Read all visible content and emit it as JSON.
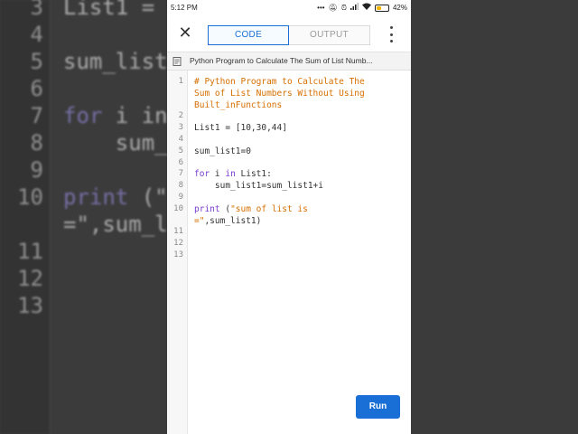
{
  "background": {
    "lines": [
      {
        "no": "3",
        "text": "List1 = "
      },
      {
        "no": "4",
        "text": ""
      },
      {
        "no": "5",
        "text": "sum_list"
      },
      {
        "no": "6",
        "text": ""
      },
      {
        "no": "7",
        "kw": "for",
        "text": " i in"
      },
      {
        "no": "8",
        "text": "    sum_"
      },
      {
        "no": "9",
        "text": ""
      },
      {
        "no": "10",
        "kw": "print",
        "text": " (\""
      },
      {
        "no": "",
        "text": "=\",sum_l"
      },
      {
        "no": "11",
        "text": ""
      },
      {
        "no": "12",
        "text": ""
      },
      {
        "no": "13",
        "text": ""
      }
    ]
  },
  "status_bar": {
    "time": "5:12 PM",
    "icons": [
      "dots-icon",
      "mute-icon",
      "alarm-icon",
      "signal-icon",
      "wifi-icon"
    ],
    "battery": "42%",
    "battery_level": 0.42
  },
  "toolbar": {
    "tabs": [
      {
        "label": "CODE",
        "active": true
      },
      {
        "label": "OUTPUT",
        "active": false
      }
    ]
  },
  "file": {
    "title": "Python Program to Calculate The Sum of List Numb..."
  },
  "editor": {
    "lines": [
      {
        "no": "1",
        "segments": [
          {
            "t": "# Python Program to Calculate The",
            "c": "comment"
          }
        ]
      },
      {
        "no": "",
        "segments": [
          {
            "t": "Sum of List Numbers Without Using",
            "c": "comment"
          }
        ]
      },
      {
        "no": "",
        "segments": [
          {
            "t": "Built_inFunctions",
            "c": "comment"
          }
        ]
      },
      {
        "no": "2",
        "segments": []
      },
      {
        "no": "3",
        "segments": [
          {
            "t": "List1 = [10,30,44]",
            "c": ""
          }
        ]
      },
      {
        "no": "4",
        "segments": []
      },
      {
        "no": "5",
        "segments": [
          {
            "t": "sum_list1=0",
            "c": ""
          }
        ]
      },
      {
        "no": "6",
        "segments": []
      },
      {
        "no": "7",
        "segments": [
          {
            "t": "for",
            "c": "kw"
          },
          {
            "t": " i ",
            "c": ""
          },
          {
            "t": "in",
            "c": "kw"
          },
          {
            "t": " List1:",
            "c": ""
          }
        ]
      },
      {
        "no": "8",
        "segments": [
          {
            "t": "    sum_list1=sum_list1+i",
            "c": ""
          }
        ]
      },
      {
        "no": "9",
        "segments": []
      },
      {
        "no": "10",
        "segments": [
          {
            "t": "print",
            "c": "kw"
          },
          {
            "t": " (",
            "c": ""
          },
          {
            "t": "\"sum of list is",
            "c": "str"
          }
        ]
      },
      {
        "no": "",
        "segments": [
          {
            "t": "=\"",
            "c": "str"
          },
          {
            "t": ",sum_list1)",
            "c": ""
          }
        ]
      },
      {
        "no": "11",
        "segments": []
      },
      {
        "no": "12",
        "segments": []
      },
      {
        "no": "13",
        "segments": []
      }
    ]
  },
  "run_button": {
    "label": "Run"
  },
  "colors": {
    "accent": "#1a6fd6",
    "comment": "#d66f00",
    "keyword": "#7a3ad0"
  }
}
